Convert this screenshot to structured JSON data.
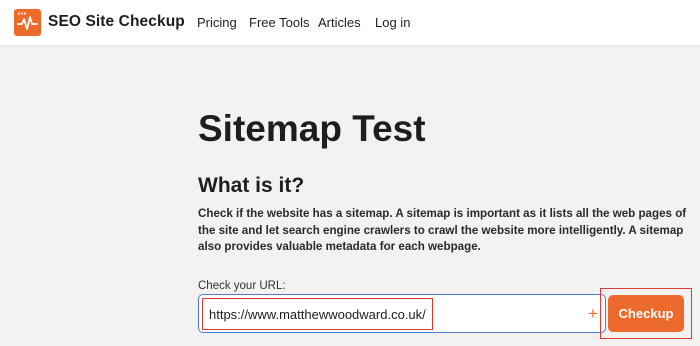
{
  "header": {
    "brand": "SEO Site Checkup",
    "nav": [
      "Pricing",
      "Free Tools",
      "Articles",
      "Log in"
    ]
  },
  "main": {
    "title": "Sitemap Test",
    "subtitle": "What is it?",
    "description": "Check if the website has a sitemap. A sitemap is important as it lists all the web pages of the site and let search engine crawlers to crawl the website more intelligently. A sitemap also provides valuable metadata for each webpage.",
    "url_label": "Check your URL:",
    "url_value": "https://www.matthewwoodward.co.uk/",
    "plus_icon": "+",
    "button_label": "Checkup"
  },
  "colors": {
    "accent": "#ec6a2c",
    "highlight": "#d93b3b",
    "input_border": "#4d7bd6"
  },
  "icons": {
    "logo": "pulse-window-icon",
    "plus": "plus-icon"
  }
}
